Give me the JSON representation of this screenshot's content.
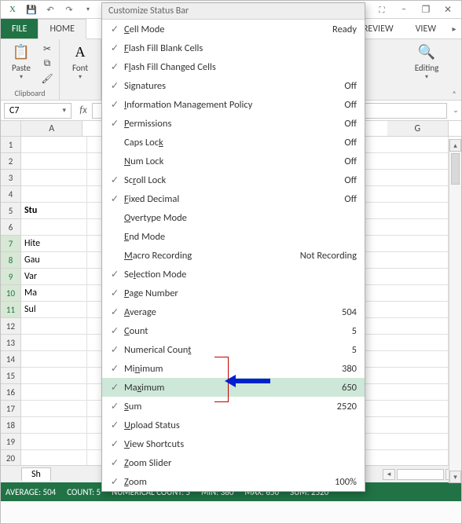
{
  "qat": {
    "undo_tip": "Undo",
    "redo_tip": "Redo",
    "save_tip": "Save"
  },
  "window": {
    "min": "–",
    "max": "▢",
    "close": "✕",
    "help": "?",
    "ribbon_toggle": "▾",
    "restore": "❐"
  },
  "tabs": {
    "file": "FILE",
    "home": "HOME",
    "review": "REVIEW",
    "view": "VIEW"
  },
  "ribbon": {
    "clipboard": {
      "label": "Clipboard",
      "paste": "Paste"
    },
    "font": {
      "label": "Font"
    },
    "editing": {
      "label": "Editing"
    }
  },
  "namebox": "C7",
  "columns": [
    "A",
    "G"
  ],
  "rows": [
    {
      "n": 1
    },
    {
      "n": 2
    },
    {
      "n": 3
    },
    {
      "n": 4
    },
    {
      "n": 5,
      "a": "Stu"
    },
    {
      "n": 6
    },
    {
      "n": 7,
      "a": "Hite",
      "sel": true
    },
    {
      "n": 8,
      "a": "Gau",
      "sel": true
    },
    {
      "n": 9,
      "a": "Var",
      "sel": true
    },
    {
      "n": 10,
      "a": "Ma",
      "sel": true
    },
    {
      "n": 11,
      "a": "Sul",
      "sel": true
    },
    {
      "n": 12
    },
    {
      "n": 13
    },
    {
      "n": 14
    },
    {
      "n": 15
    },
    {
      "n": 16
    },
    {
      "n": 17
    },
    {
      "n": 18
    },
    {
      "n": 19
    },
    {
      "n": 20
    }
  ],
  "sheet_tab": "Sh",
  "statusbar": {
    "average": "AVERAGE: 504",
    "count": "COUNT: 5",
    "numcount": "NUMERICAL COUNT: 5",
    "min": "MIN: 380",
    "max": "MAX: 650",
    "sum": "SUM: 2520"
  },
  "menu": {
    "title": "Customize Status Bar",
    "items": [
      {
        "checked": true,
        "label_pre": "",
        "key": "C",
        "label_post": "ell Mode",
        "value": "Ready"
      },
      {
        "checked": true,
        "label_pre": "",
        "key": "F",
        "label_post": "lash Fill Blank Cells",
        "value": ""
      },
      {
        "checked": true,
        "label_pre": "F",
        "key": "l",
        "label_post": "ash Fill Changed Cells",
        "value": ""
      },
      {
        "checked": true,
        "label_pre": "Si",
        "key": "g",
        "label_post": "natures",
        "value": "Off"
      },
      {
        "checked": true,
        "label_pre": "",
        "key": "I",
        "label_post": "nformation Management Policy",
        "value": "Off"
      },
      {
        "checked": true,
        "label_pre": "",
        "key": "P",
        "label_post": "ermissions",
        "value": "Off"
      },
      {
        "checked": false,
        "label_pre": "Caps Loc",
        "key": "k",
        "label_post": "",
        "value": "Off"
      },
      {
        "checked": false,
        "label_pre": "",
        "key": "N",
        "label_post": "um Lock",
        "value": "Off"
      },
      {
        "checked": true,
        "label_pre": "Sc",
        "key": "r",
        "label_post": "oll Lock",
        "value": "Off"
      },
      {
        "checked": true,
        "label_pre": "",
        "key": "F",
        "label_post": "ixed Decimal",
        "value": "Off"
      },
      {
        "checked": false,
        "label_pre": "",
        "key": "O",
        "label_post": "vertype Mode",
        "value": ""
      },
      {
        "checked": false,
        "label_pre": "",
        "key": "E",
        "label_post": "nd Mode",
        "value": ""
      },
      {
        "checked": false,
        "label_pre": "",
        "key": "M",
        "label_post": "acro Recording",
        "value": "Not Recording"
      },
      {
        "checked": true,
        "label_pre": "Se",
        "key": "l",
        "label_post": "ection Mode",
        "value": ""
      },
      {
        "checked": true,
        "label_pre": "",
        "key": "P",
        "label_post": "age Number",
        "value": ""
      },
      {
        "checked": true,
        "label_pre": "",
        "key": "A",
        "label_post": "verage",
        "value": "504"
      },
      {
        "checked": true,
        "label_pre": "",
        "key": "C",
        "label_post": "ount",
        "value": "5"
      },
      {
        "checked": true,
        "label_pre": "Numerical Coun",
        "key": "t",
        "label_post": "",
        "value": "5"
      },
      {
        "checked": true,
        "label_pre": "Mi",
        "key": "n",
        "label_post": "imum",
        "value": "380"
      },
      {
        "checked": true,
        "label_pre": "Ma",
        "key": "x",
        "label_post": "imum",
        "value": "650",
        "hover": true
      },
      {
        "checked": true,
        "label_pre": "",
        "key": "S",
        "label_post": "um",
        "value": "2520"
      },
      {
        "checked": true,
        "label_pre": "",
        "key": "U",
        "label_post": "pload Status",
        "value": ""
      },
      {
        "checked": true,
        "label_pre": "",
        "key": "V",
        "label_post": "iew Shortcuts",
        "value": ""
      },
      {
        "checked": true,
        "label_pre": "",
        "key": "Z",
        "label_post": "oom Slider",
        "value": ""
      },
      {
        "checked": true,
        "label_pre": "",
        "key": "Z",
        "label_post": "oom",
        "value": "100%"
      }
    ]
  }
}
